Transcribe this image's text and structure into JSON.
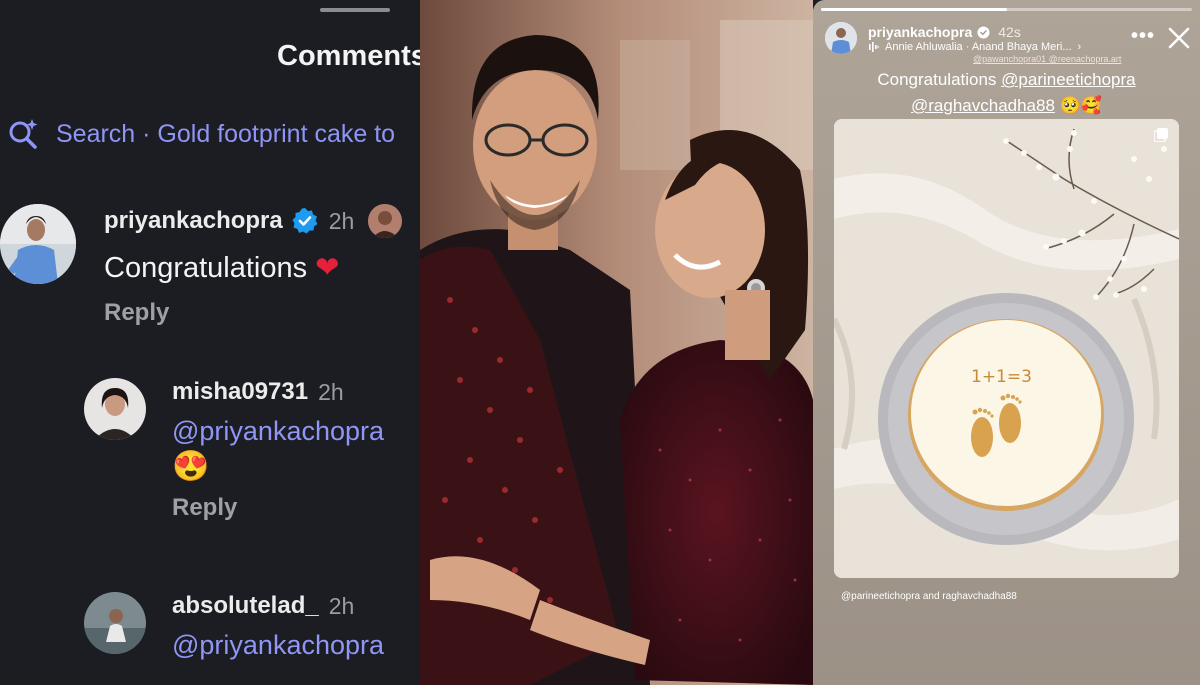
{
  "comments_panel": {
    "title": "Comments",
    "search_text": "Search · Gold footprint cake to",
    "comments": [
      {
        "username": "priyankachopra",
        "time": "2h",
        "text": "Congratulations",
        "emoji": "❤",
        "reply": "Reply"
      },
      {
        "username": "misha09731",
        "time": "2h",
        "mention": "@priyankachopra",
        "emoji": "😍",
        "reply": "Reply"
      },
      {
        "username": "absolutelad_",
        "time": "2h",
        "mention": "@priyankachopra"
      }
    ]
  },
  "story": {
    "username": "priyankachopra",
    "time": "42s",
    "music": "Annie Ahluwalia · Anand Bhaya Meri...",
    "credits": "@pawanchopra01 @reenachopra.art",
    "more": "•••",
    "caption_line1_prefix": "Congratulations",
    "caption_mention1": "@parineetichopra",
    "caption_mention2": "@raghavchadha88",
    "caption_emojis": "🥺🥰",
    "cake_text": "1+1=3",
    "tag_line": "@parineetichopra and raghavchadha88"
  },
  "colors": {
    "comments_bg": "#1b1d23",
    "mention_blue": "#8f96f5",
    "verified_blue": "#1d9bf0",
    "heart_red": "#e5203a"
  },
  "icons": [
    "search-sparkle-icon",
    "verified-badge-icon",
    "music-icon",
    "more-icon",
    "close-icon",
    "multi-photo-icon"
  ]
}
